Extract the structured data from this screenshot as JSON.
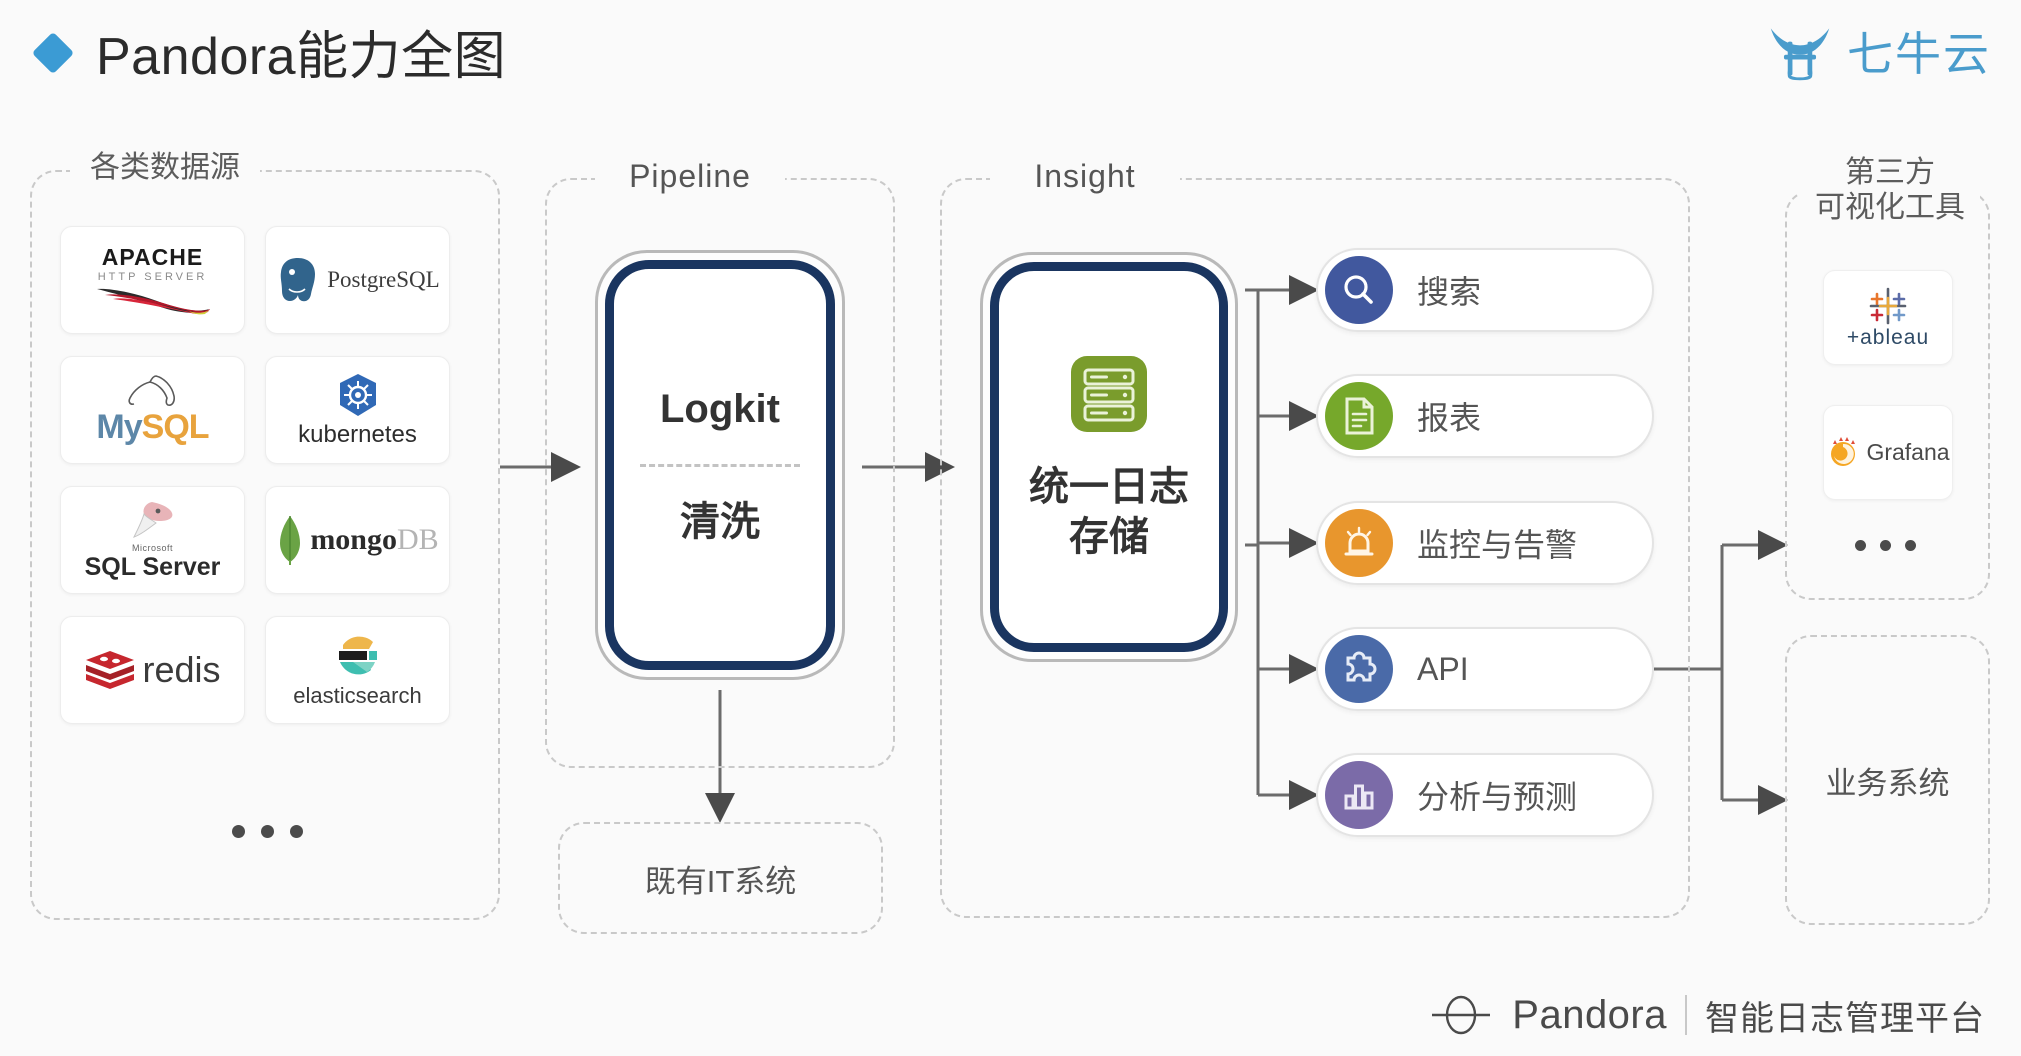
{
  "header": {
    "title": "Pandora能力全图",
    "bullet_icon": "diamond-icon",
    "brand_name": "七牛云",
    "brand_color": "#4a9ccc",
    "accent_color": "#3b9bd4"
  },
  "groups": {
    "sources": {
      "label": "各类数据源"
    },
    "pipeline": {
      "label": "Pipeline"
    },
    "insight": {
      "label": "Insight"
    },
    "third_party": {
      "label": "第三方\n可视化工具",
      "line1": "第三方",
      "line2": "可视化工具"
    }
  },
  "data_sources": [
    {
      "name": "Apache HTTP Server",
      "line1": "APACHE",
      "line2": "HTTP SERVER",
      "icon": "apache-feather-icon"
    },
    {
      "name": "PostgreSQL",
      "line1": "PostgreSQL",
      "icon": "postgresql-elephant-icon"
    },
    {
      "name": "MySQL",
      "line1": "MySQL",
      "icon": "mysql-dolphin-icon"
    },
    {
      "name": "kubernetes",
      "line1": "kubernetes",
      "icon": "kubernetes-helm-icon"
    },
    {
      "name": "Microsoft SQL Server",
      "line1": "Microsoft",
      "line2": "SQL Server",
      "icon": "sqlserver-icon"
    },
    {
      "name": "mongoDB",
      "line1": "mongo",
      "line2": "DB",
      "icon": "mongodb-leaf-icon"
    },
    {
      "name": "redis",
      "line1": "redis",
      "icon": "redis-stack-icon"
    },
    {
      "name": "elasticsearch",
      "line1": "elasticsearch",
      "icon": "elasticsearch-icon"
    }
  ],
  "data_sources_more": "•••",
  "pipeline": {
    "box_title": "Logkit",
    "box_subtitle": "清洗",
    "downstream": "既有IT系统"
  },
  "insight": {
    "icon": "server-rack-icon",
    "icon_color": "#7a9c2c",
    "box_line1": "统一日志",
    "box_line2": "存储"
  },
  "capabilities": [
    {
      "label": "搜索",
      "icon": "search-icon",
      "color": "#41589e"
    },
    {
      "label": "报表",
      "icon": "report-document-icon",
      "color": "#76a82b"
    },
    {
      "label": "监控与告警",
      "icon": "alarm-siren-icon",
      "color": "#e8962d"
    },
    {
      "label": "API",
      "icon": "puzzle-piece-icon",
      "color": "#4a6aa8"
    },
    {
      "label": "分析与预测",
      "icon": "bar-chart-icon",
      "color": "#7b6ba8"
    }
  ],
  "third_party_tools": [
    {
      "name": "tableau",
      "label": "+ableau",
      "icon": "tableau-icon"
    },
    {
      "name": "Grafana",
      "label": "Grafana",
      "icon": "grafana-spiral-icon"
    }
  ],
  "third_party_more": "•••",
  "business_system": {
    "label": "业务系统"
  },
  "footer": {
    "logo_icon": "pandora-ring-icon",
    "name": "Pandora",
    "subtitle": "智能日志管理平台"
  }
}
